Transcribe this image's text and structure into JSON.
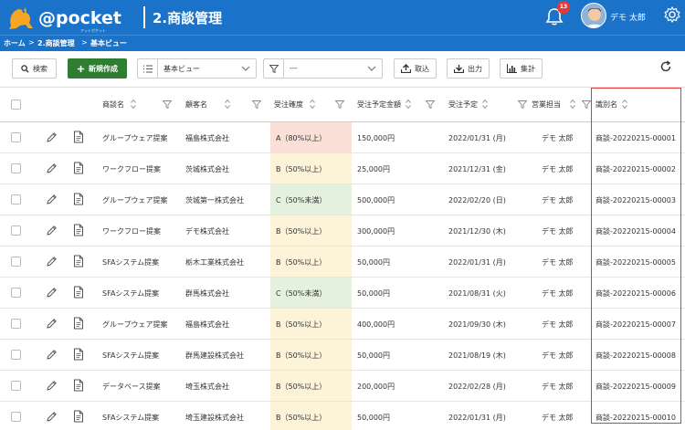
{
  "header": {
    "logo_text": "@pocket",
    "logo_sub": "アットポケット",
    "page_title": "2.商談管理",
    "notification_count": "13",
    "user_name": "デモ 太郎"
  },
  "breadcrumb": [
    "ホーム",
    "2.商談管理",
    "基本ビュー"
  ],
  "toolbar": {
    "search_label": "検索",
    "new_label": "新規作成",
    "view_value": "基本ビュー",
    "filter_value": "---",
    "import_label": "取込",
    "export_label": "出力",
    "aggregate_label": "集計"
  },
  "table": {
    "columns": [
      "商談名",
      "顧客名",
      "受注確度",
      "受注予定金額",
      "受注予定",
      "営業担当",
      "識別名"
    ],
    "rows": [
      {
        "name": "グループウェア提案",
        "customer": "福島株式会社",
        "confidence": "A（80%以上）",
        "level": "a",
        "amount": "150,000円",
        "date": "2022/01/31 (月)",
        "rep": "デモ 太郎",
        "id": "商談-20220215-00001"
      },
      {
        "name": "ワークフロー提案",
        "customer": "茨城株式会社",
        "confidence": "B（50%以上）",
        "level": "b",
        "amount": "25,000円",
        "date": "2021/12/31 (金)",
        "rep": "デモ 太郎",
        "id": "商談-20220215-00002"
      },
      {
        "name": "グループウェア提案",
        "customer": "茨城第一株式会社",
        "confidence": "C（50%未満）",
        "level": "c",
        "amount": "500,000円",
        "date": "2022/02/20 (日)",
        "rep": "デモ 太郎",
        "id": "商談-20220215-00003"
      },
      {
        "name": "ワークフロー提案",
        "customer": "デモ株式会社",
        "confidence": "B（50%以上）",
        "level": "b",
        "amount": "300,000円",
        "date": "2021/12/30 (木)",
        "rep": "デモ 太郎",
        "id": "商談-20220215-00004"
      },
      {
        "name": "SFAシステム提案",
        "customer": "栃木工業株式会社",
        "confidence": "B（50%以上）",
        "level": "b",
        "amount": "50,000円",
        "date": "2022/01/31 (月)",
        "rep": "デモ 太郎",
        "id": "商談-20220215-00005"
      },
      {
        "name": "SFAシステム提案",
        "customer": "群馬株式会社",
        "confidence": "C（50%未満）",
        "level": "c",
        "amount": "50,000円",
        "date": "2021/08/31 (火)",
        "rep": "デモ 太郎",
        "id": "商談-20220215-00006"
      },
      {
        "name": "グループウェア提案",
        "customer": "福島株式会社",
        "confidence": "B（50%以上）",
        "level": "b",
        "amount": "400,000円",
        "date": "2021/09/30 (木)",
        "rep": "デモ 太郎",
        "id": "商談-20220215-00007"
      },
      {
        "name": "SFAシステム提案",
        "customer": "群馬建設株式会社",
        "confidence": "B（50%以上）",
        "level": "b",
        "amount": "50,000円",
        "date": "2021/08/19 (木)",
        "rep": "デモ 太郎",
        "id": "商談-20220215-00008"
      },
      {
        "name": "データベース提案",
        "customer": "埼玉株式会社",
        "confidence": "B（50%以上）",
        "level": "b",
        "amount": "200,000円",
        "date": "2022/02/28 (月)",
        "rep": "デモ 太郎",
        "id": "商談-20220215-00009"
      },
      {
        "name": "SFAシステム提案",
        "customer": "埼玉建設株式会社",
        "confidence": "B（50%以上）",
        "level": "b",
        "amount": "50,000円",
        "date": "2022/01/31 (月)",
        "rep": "デモ 太郎",
        "id": "商談-20220215-00010"
      }
    ]
  },
  "colors": {
    "header_bg": "#1a73c8",
    "primary_button": "#2e7d32",
    "confidence_a": "#fbe0d7",
    "confidence_b": "#fdf3d9",
    "confidence_c": "#e4f1de",
    "highlight_border": "#e53935"
  }
}
